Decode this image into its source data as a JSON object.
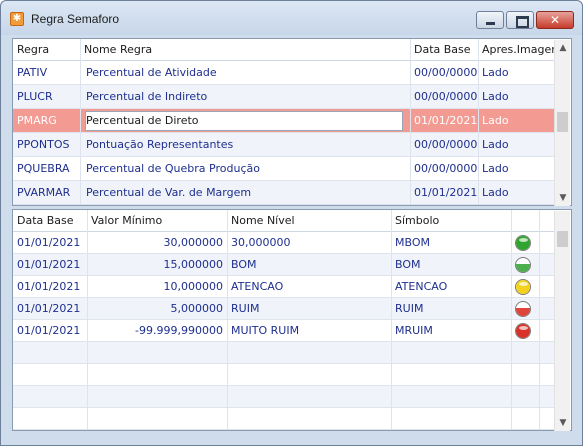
{
  "window": {
    "title": "Regra Semaforo",
    "icon": "app-orange-icon"
  },
  "top_grid": {
    "headers": [
      "Regra",
      "Nome Regra",
      "Data Base",
      "Apres.Imagem"
    ],
    "rows": [
      {
        "regra": "PATIV",
        "nome": "Percentual de Atividade",
        "data": "00/00/0000",
        "apres": "Lado"
      },
      {
        "regra": "PLUCR",
        "nome": "Percentual de Indireto",
        "data": "00/00/0000",
        "apres": "Lado"
      },
      {
        "regra": "PMARG",
        "nome": "Percentual de Direto",
        "data": "01/01/2021",
        "apres": "Lado"
      },
      {
        "regra": "PPONTOS",
        "nome": "Pontuação Representantes",
        "data": "00/00/0000",
        "apres": "Lado"
      },
      {
        "regra": "PQUEBRA",
        "nome": "Percentual de Quebra Produção",
        "data": "00/00/0000",
        "apres": "Lado"
      },
      {
        "regra": "PVARMAR",
        "nome": "Percentual de Var. de Margem",
        "data": "01/01/2021",
        "apres": "Lado"
      }
    ],
    "selected_index": 2
  },
  "bottom_grid": {
    "headers": [
      "Data Base",
      "Valor Mínimo",
      "Nome Nível",
      "Símbolo",
      ""
    ],
    "rows": [
      {
        "data": "01/01/2021",
        "valor": "30,000000",
        "nivel": "30,000000",
        "simbolo": "MBOM",
        "light": "green",
        "color": "#2fa52f"
      },
      {
        "data": "01/01/2021",
        "valor": "15,000000",
        "nivel": "BOM",
        "simbolo": "BOM",
        "light": "green-half",
        "color": "#4bb04b"
      },
      {
        "data": "01/01/2021",
        "valor": "10,000000",
        "nivel": "ATENCAO",
        "simbolo": "ATENCAO",
        "light": "yellow",
        "color": "#f2d21e"
      },
      {
        "data": "01/01/2021",
        "valor": "5,000000",
        "nivel": "RUIM",
        "simbolo": "RUIM",
        "light": "red-half",
        "color": "#e0453a"
      },
      {
        "data": "01/01/2021",
        "valor": "-99.999,990000",
        "nivel": "MUITO RUIM",
        "simbolo": "MRUIM",
        "light": "red",
        "color": "#d8322a"
      }
    ],
    "empty_rows": 4
  }
}
